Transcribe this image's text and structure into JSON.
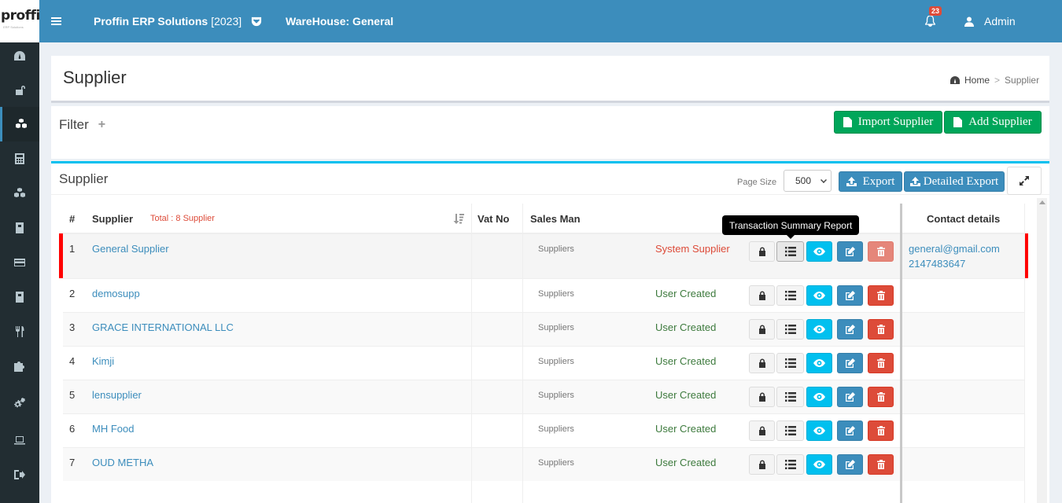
{
  "app": {
    "logo_text": "proffin",
    "logo_sub": "ERP Solutions",
    "title": "Proffin ERP Solutions",
    "year": "[2023]",
    "warehouse": "WareHouse: General",
    "notification_count": "23",
    "user": "Admin"
  },
  "sidebar": {
    "icons": [
      "dashboard-icon",
      "unlock-icon",
      "cubes-icon",
      "calculator-icon",
      "cubes-icon",
      "book-icon",
      "credit-card-icon",
      "book-icon",
      "cutlery-icon",
      "puzzle-icon",
      "cogs-icon",
      "laptop-icon",
      "sign-out-icon"
    ],
    "active_index": 2
  },
  "page": {
    "title": "Supplier",
    "breadcrumb": {
      "home": "Home",
      "sep": ">",
      "current": "Supplier"
    }
  },
  "filter": {
    "title": "Filter",
    "plus": "+",
    "import_label": "Import Supplier",
    "add_label": "Add Supplier"
  },
  "list": {
    "title": "Supplier",
    "page_size_label": "Page Size",
    "page_size_value": "500",
    "export_label": "Export",
    "detailed_export_label": "Detailed Export"
  },
  "table": {
    "columns": {
      "num": "#",
      "supplier": "Supplier",
      "total": "Total : 8 Supplier",
      "vat": "Vat No",
      "salesman": "Sales Man",
      "contact": "Contact details"
    },
    "tooltip": "Transaction Summary Report",
    "rows": [
      {
        "num": "1",
        "name": "General Supplier",
        "salesman": "Suppliers",
        "type": "System Supplier",
        "email": "general@gmail.com",
        "phone": "2147483647"
      },
      {
        "num": "2",
        "name": "demosupp",
        "salesman": "Suppliers",
        "type": "User Created",
        "email": "",
        "phone": ""
      },
      {
        "num": "3",
        "name": "GRACE INTERNATIONAL LLC",
        "salesman": "Suppliers",
        "type": "User Created",
        "email": "",
        "phone": ""
      },
      {
        "num": "4",
        "name": "Kimji",
        "salesman": "Suppliers",
        "type": "User Created",
        "email": "",
        "phone": ""
      },
      {
        "num": "5",
        "name": "lensupplier",
        "salesman": "Suppliers",
        "type": "User Created",
        "email": "",
        "phone": ""
      },
      {
        "num": "6",
        "name": "MH Food",
        "salesman": "Suppliers",
        "type": "User Created",
        "email": "",
        "phone": ""
      },
      {
        "num": "7",
        "name": "OUD METHA",
        "salesman": "Suppliers",
        "type": "User Created",
        "email": "",
        "phone": ""
      }
    ]
  }
}
